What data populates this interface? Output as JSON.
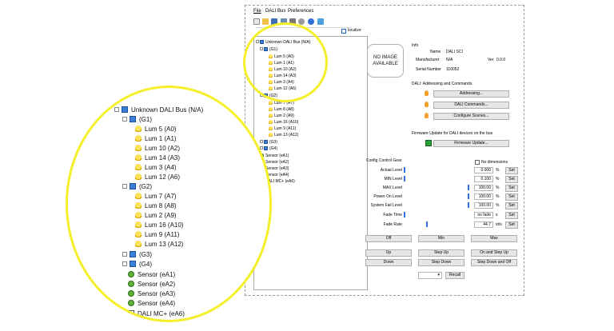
{
  "menu": {
    "file": "File",
    "dali_bus": "DALI Bus",
    "preferences": "Preferences"
  },
  "toolbar": {
    "icons": [
      "new-file-icon",
      "open-folder-icon",
      "save-icon",
      "network-icon",
      "tools-icon",
      "search-icon",
      "info-icon",
      "refresh-icon"
    ]
  },
  "localize_label": "localize",
  "tree": {
    "root": "Unknown DALI Bus (N/A)",
    "g1": "(G1)",
    "g1_items": [
      "Lum 5 (A0)",
      "Lum 1 (A1)",
      "Lum 10 (A2)",
      "Lum 14 (A3)",
      "Lum 3 (A4)",
      "Lum 12 (A6)"
    ],
    "g2": "(G2)",
    "g2_items": [
      "Lum 7 (A7)",
      "Lum 8 (A8)",
      "Lum 2 (A9)",
      "Lum 16 (A10)",
      "Lum 9 (A11)",
      "Lum 13 (A12)"
    ],
    "g3": "(G3)",
    "g4": "(G4)",
    "sensors": [
      "Sensor (eA1)",
      "Sensor (eA2)",
      "Sensor (eA3)",
      "Sensor (eA4)"
    ],
    "mc": "DALI MC+ (eA6)"
  },
  "zoom_tree": {
    "root": "Unknown DALI Bus (N/A)",
    "g1": "(G1)",
    "g1_items": [
      "Lum 5 (A0)",
      "Lum 1 (A1)",
      "Lum 10 (A2)",
      "Lum 14 (A3)",
      "Lum 3 (A4)",
      "Lum 12 (A6)"
    ],
    "g2": "(G2)",
    "g2_items": [
      "Lum 7 (A7)",
      "Lum 8 (A8)",
      "Lum 2 (A9)",
      "Lum 16 (A10)",
      "Lum 9 (A11)",
      "Lum 13 (A12)"
    ],
    "g3": "(G3)",
    "g4": "(G4)",
    "sensors": [
      "Sensor (eA1)",
      "Sensor (eA2)",
      "Sensor (eA3)",
      "Sensor (eA4)"
    ],
    "mc": "DALI MC+ (eA6)"
  },
  "noimage": {
    "line1": "NO IMAGE",
    "line2": "AVAILABLE"
  },
  "info": {
    "heading": "Info",
    "name_label": "Name",
    "name_value": "DALI SCI",
    "manufacturer_label": "Manufacturer",
    "manufacturer_value": "N/A",
    "version_label": "Ver",
    "version_value": "0.0.0",
    "serial_label": "Serial Number",
    "serial_value": "110052"
  },
  "addressing": {
    "heading": "DALI: Addressing and Commands",
    "addressing_button": "Addressing...",
    "commands_button": "DALI Commands...",
    "scenes_button": "Configure Scenes..."
  },
  "firmware": {
    "heading": "Firmware Update for DALI devices on the bus",
    "button": "Firmware Update..."
  },
  "config": {
    "heading": "Config Control Gear",
    "no_dimensions": "No dimensions",
    "rows": [
      {
        "label": "Actual Level",
        "value": "0.000",
        "unit": "%",
        "set": "Set",
        "level": 0
      },
      {
        "label": "MIN Level",
        "value": "0.100",
        "unit": "%",
        "set": "Set",
        "level": 0.001
      },
      {
        "label": "MAX Level",
        "value": "100.00",
        "unit": "%",
        "set": "Set",
        "level": 1
      },
      {
        "label": "Power On Level",
        "value": "100.00",
        "unit": "%",
        "set": "Set",
        "level": 1
      },
      {
        "label": "System Fail Level",
        "value": "100.00",
        "unit": "%",
        "set": "Set",
        "level": 1
      },
      {
        "label": "Fade Time",
        "value": "no fade",
        "unit": "s",
        "set": "Set",
        "level": 0
      },
      {
        "label": "Fade Rate",
        "value": "44.7",
        "unit": "st/s",
        "set": "Set",
        "level": 0.35
      }
    ]
  },
  "buttons": {
    "off": "Off",
    "min": "Min",
    "max": "Max",
    "up": "Up",
    "step_up": "Step Up",
    "on_and_step_up": "On and Step Up",
    "down": "Down",
    "step_down": "Step Down",
    "step_down_and_off": "Step Down and Off",
    "recall": "Recall"
  },
  "colors": {
    "highlight": "#f5ef2a",
    "accent": "#2f6ed9"
  }
}
